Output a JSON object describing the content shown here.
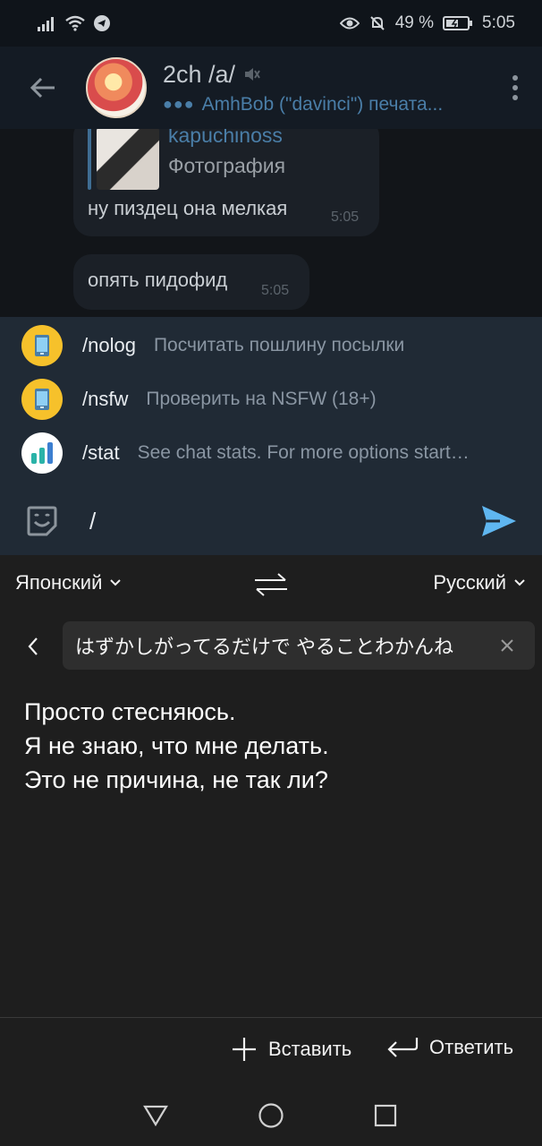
{
  "status_bar": {
    "battery_percent": "49 %",
    "time": "5:05"
  },
  "chat": {
    "title": "2ch /a/",
    "subtitle": "AmhBob (\"davinci\") печата...",
    "messages": [
      {
        "reply_to_name": "kapuchinoss",
        "reply_to_type": "Фотография",
        "text": "ну пиздец она мелкая",
        "time": "5:05"
      },
      {
        "text": "опять пидофид",
        "time": "5:05"
      }
    ],
    "commands": [
      {
        "name": "/nolog",
        "description": "Посчитать пошлину посылки",
        "icon": "phone-app-icon"
      },
      {
        "name": "/nsfw",
        "description": "Проверить на NSFW (18+)",
        "icon": "phone-app-icon"
      },
      {
        "name": "/stat",
        "description": "See chat stats. For more options start…",
        "icon": "bar-chart-icon"
      }
    ],
    "input_value": "/"
  },
  "translator": {
    "source_language": "Японский",
    "target_language": "Русский",
    "input_text": "はずかしがってるだけで やることわかんね",
    "result_lines": [
      "Просто стесняюсь.",
      "Я не знаю, что мне делать.",
      "Это не причина, не так ли?"
    ],
    "insert_label": "Вставить",
    "reply_label": "Ответить"
  },
  "colors": {
    "accent": "#4a7ea8",
    "send": "#5fb6f0",
    "command_icon_yellow": "#f6c12b"
  }
}
